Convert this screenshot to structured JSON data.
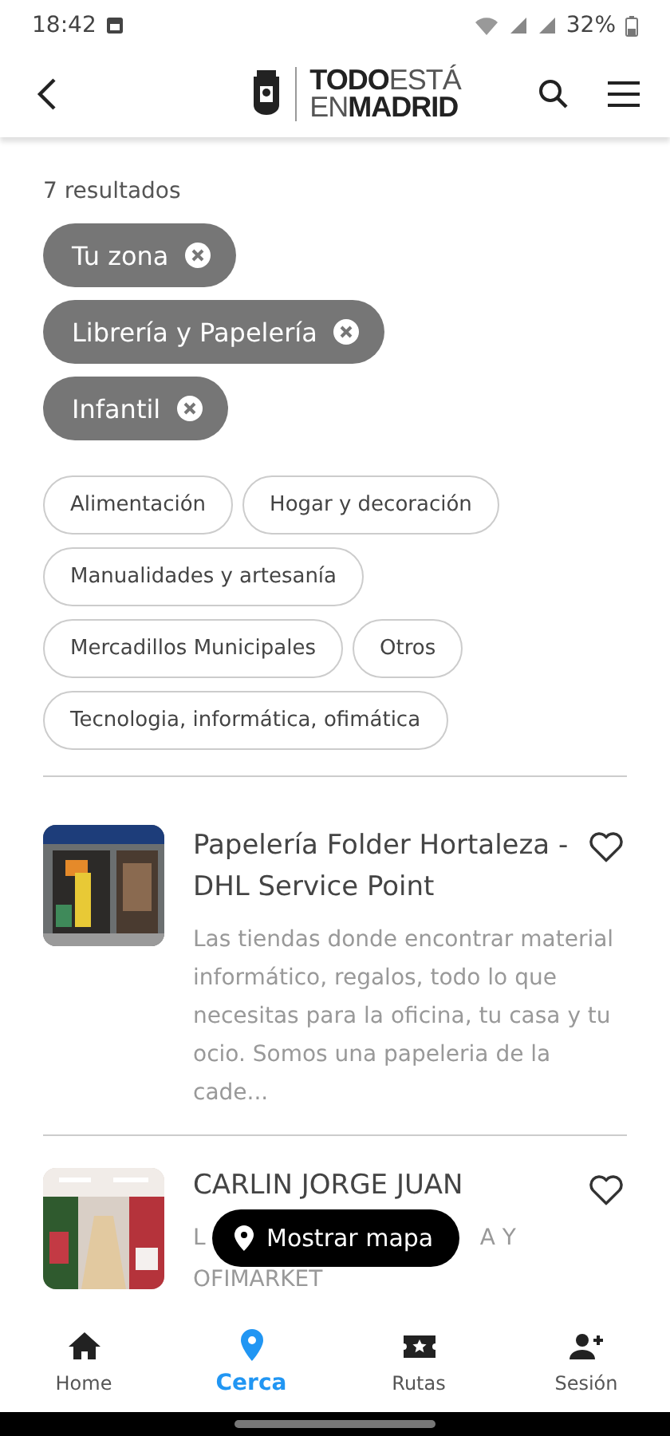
{
  "status_bar": {
    "time": "18:42",
    "battery": "32%"
  },
  "header": {
    "logo_line_1_bold": "TODO",
    "logo_line_1_light": "ESTÁ",
    "logo_line_2_light": "EN",
    "logo_line_2_bold": "MADRID"
  },
  "results_count": "7 resultados",
  "filters": [
    {
      "label": "Tu zona",
      "selected": true
    },
    {
      "label": "Librería y Papelería",
      "selected": true
    },
    {
      "label": "Infantil",
      "selected": true
    },
    {
      "label": "Alimentación",
      "selected": false
    },
    {
      "label": "Hogar y decoración",
      "selected": false
    },
    {
      "label": "Manualidades y artesanía",
      "selected": false
    },
    {
      "label": "Mercadillos Municipales",
      "selected": false
    },
    {
      "label": "Otros",
      "selected": false
    },
    {
      "label": "Tecnologia, informática, ofimática",
      "selected": false
    }
  ],
  "results": [
    {
      "title": "Papelería Folder Hortaleza - DHL Service Point",
      "description": "Las tiendas donde encontrar material informático, regalos, todo lo que necesitas para la oficina, tu casa y tu ocio. Somos una papeleria de la cade...",
      "favorite": false
    },
    {
      "title": "CARLIN JORGE JUAN",
      "description_line_1_start": "L",
      "description_line_1_end": "A Y",
      "description_line_2": "OFIMARKET",
      "favorite": false
    }
  ],
  "map_button": {
    "label": "Mostrar mapa"
  },
  "bottom_nav": [
    {
      "label": "Home",
      "selected": false
    },
    {
      "label": "Cerca",
      "selected": true
    },
    {
      "label": "Rutas",
      "selected": false
    },
    {
      "label": "Sesión",
      "selected": false
    }
  ]
}
